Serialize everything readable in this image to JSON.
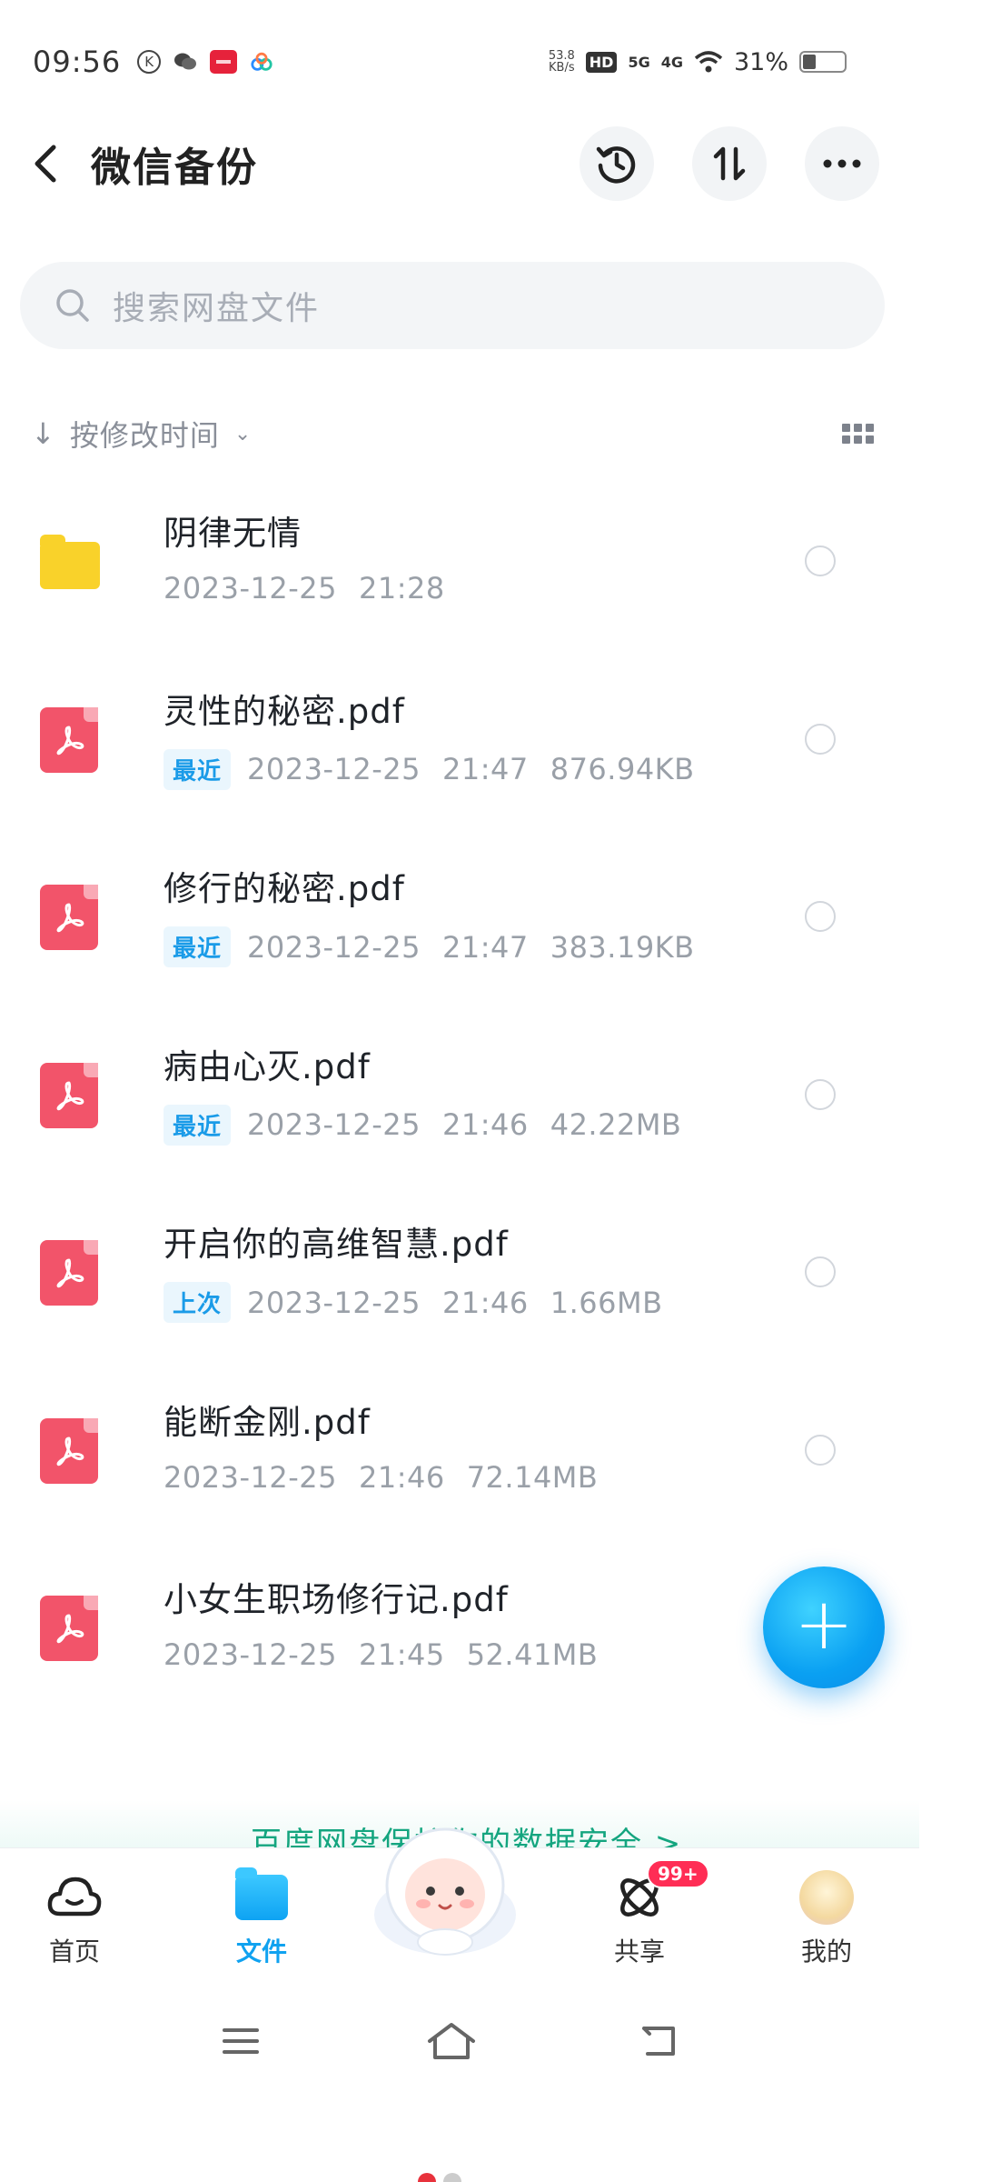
{
  "status_bar": {
    "time": "09:56",
    "speed": "53.8",
    "speed_unit": "KB/s",
    "hd_tag": "HD",
    "net1": "5G",
    "net2": "4G",
    "battery": "31%"
  },
  "header": {
    "title": "微信备份"
  },
  "search": {
    "placeholder": "搜索网盘文件"
  },
  "sort": {
    "label": "按修改时间"
  },
  "files": [
    {
      "name": "阴律无情",
      "type": "folder",
      "badge": "",
      "date": "2023-12-25",
      "time": "21:28",
      "size": ""
    },
    {
      "name": "灵性的秘密.pdf",
      "type": "pdf",
      "badge": "最近",
      "date": "2023-12-25",
      "time": "21:47",
      "size": "876.94KB"
    },
    {
      "name": "修行的秘密.pdf",
      "type": "pdf",
      "badge": "最近",
      "date": "2023-12-25",
      "time": "21:47",
      "size": "383.19KB"
    },
    {
      "name": "病由心灭.pdf",
      "type": "pdf",
      "badge": "最近",
      "date": "2023-12-25",
      "time": "21:46",
      "size": "42.22MB"
    },
    {
      "name": "开启你的高维智慧.pdf",
      "type": "pdf",
      "badge": "上次",
      "date": "2023-12-25",
      "time": "21:46",
      "size": "1.66MB"
    },
    {
      "name": "能断金刚.pdf",
      "type": "pdf",
      "badge": "",
      "date": "2023-12-25",
      "time": "21:46",
      "size": "72.14MB"
    },
    {
      "name": "小女生职场修行记.pdf",
      "type": "pdf",
      "badge": "",
      "date": "2023-12-25",
      "time": "21:45",
      "size": "52.41MB"
    }
  ],
  "safety_banner": {
    "text": "百度网盘保护你的数据安全 >"
  },
  "bottom_nav": {
    "home": "首页",
    "files": "文件",
    "share": "共享",
    "share_badge": "99+",
    "mine": "我的"
  },
  "colors": {
    "accent": "#10a2f0",
    "pdf_red": "#f2546a",
    "folder_yellow": "#f9d22a",
    "badge_blue": "#1a9be8"
  }
}
